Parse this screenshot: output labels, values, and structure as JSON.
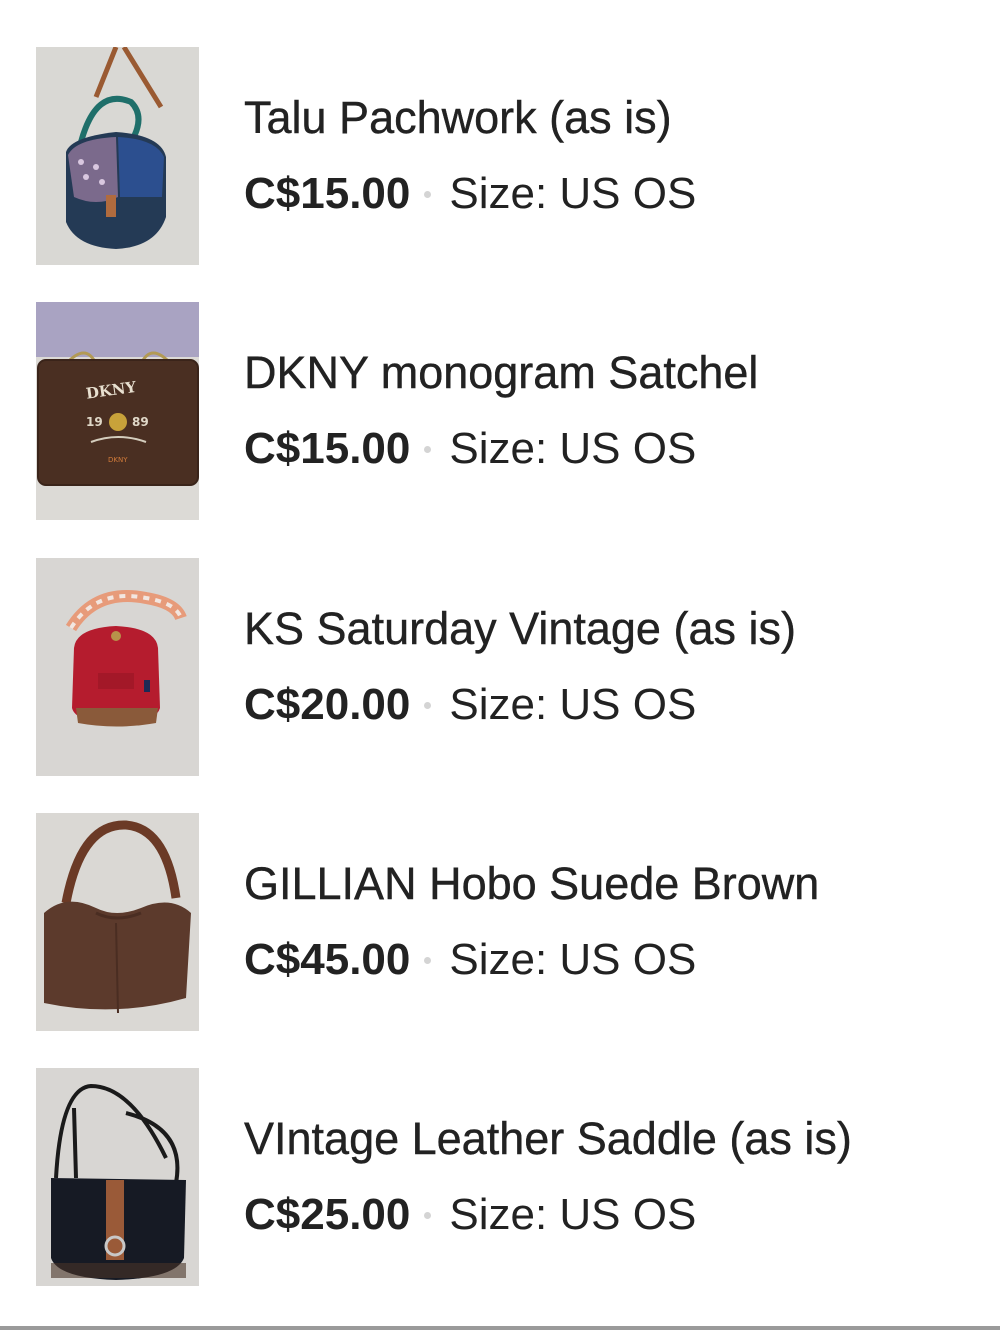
{
  "listings": [
    {
      "title": "Talu Pachwork (as is)",
      "price": "C$15.00",
      "size": "Size: US OS",
      "image_icon": "patchwork-crossbody-bag-photo"
    },
    {
      "title": "DKNY monogram Satchel",
      "price": "C$15.00",
      "size": "Size: US OS",
      "image_icon": "dkny-monogram-satchel-photo",
      "image_text": [
        "DKNY",
        "19",
        "89",
        "DKNY"
      ]
    },
    {
      "title": "KS Saturday Vintage (as is)",
      "price": "C$20.00",
      "size": "Size: US OS",
      "image_icon": "red-crossbody-bag-photo"
    },
    {
      "title": "GILLIAN Hobo Suede Brown",
      "price": "C$45.00",
      "size": "Size: US OS",
      "image_icon": "brown-suede-hobo-bag-photo"
    },
    {
      "title": "VIntage Leather Saddle (as is)",
      "price": "C$25.00",
      "size": "Size: US OS",
      "image_icon": "black-leather-saddle-bag-photo"
    }
  ],
  "colors": {
    "text": "#222222",
    "separator_dot": "#d4d4d4",
    "background": "#ffffff"
  }
}
